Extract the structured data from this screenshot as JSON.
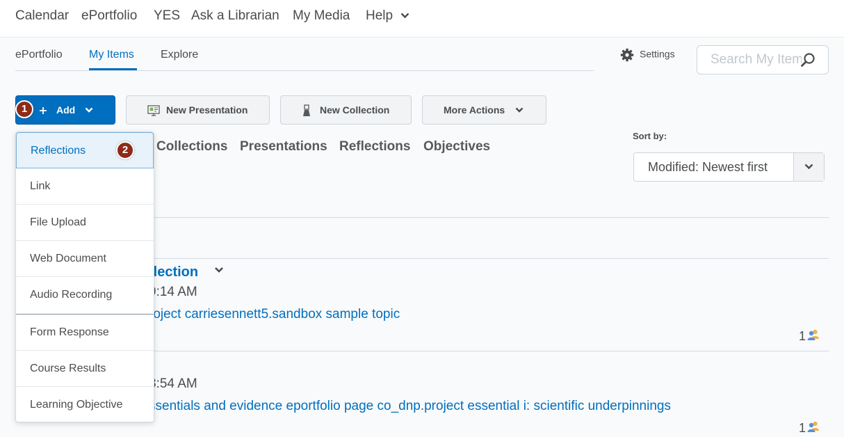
{
  "topnav": {
    "items": [
      "Calendar",
      "ePortfolio",
      "YES",
      "Ask a Librarian",
      "My Media",
      "Help"
    ]
  },
  "tabs": {
    "items": [
      "ePortfolio",
      "My Items",
      "Explore"
    ],
    "active": "My Items"
  },
  "settings": {
    "label": "Settings"
  },
  "search": {
    "placeholder": "Search My Items"
  },
  "actions": {
    "add": "Add",
    "new_presentation": "New Presentation",
    "new_collection": "New Collection",
    "more_actions": "More Actions"
  },
  "markers": [
    "1",
    "2"
  ],
  "filters": [
    "Collections",
    "Presentations",
    "Reflections",
    "Objectives"
  ],
  "sort": {
    "label": "Sort by:",
    "value": "Modified: Newest first"
  },
  "rows": [
    {
      "title_fragment": "flection",
      "time_fragment": "9:14 AM",
      "link_fragment": "roject carriesennett5.sandbox sample topic",
      "count": "1"
    },
    {
      "time_fragment": "8:54 AM",
      "link_fragment": "ssentials and evidence eportfolio page co_dnp.project essential i: scientific underpinnings",
      "count": "1"
    }
  ],
  "add_menu": {
    "items": [
      "Reflections",
      "Link",
      "File Upload",
      "Web Document",
      "Audio Recording",
      "Form Response",
      "Course Results",
      "Learning Objective"
    ],
    "selected": "Reflections"
  },
  "colors": {
    "accent": "#006fbf",
    "marker": "#8e2a18"
  },
  "icons": [
    "chevron-down-icon",
    "gear-icon",
    "search-icon",
    "plus-icon",
    "presentation-icon",
    "collection-icon",
    "users-icon"
  ]
}
